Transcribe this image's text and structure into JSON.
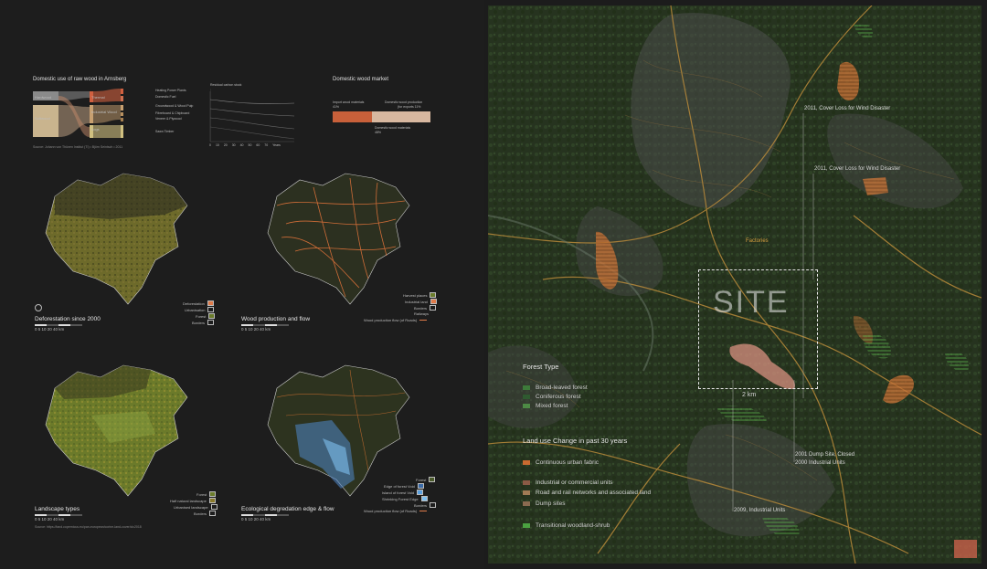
{
  "left": {
    "chart_title": "Domestic use of raw wood in Arnsberg",
    "sankey_sources": [
      "Hardwood",
      "Softwood"
    ],
    "sankey_mids": [
      "Thermal",
      "Industrial Wood",
      "Logs"
    ],
    "sankey_targets": [
      "Heating Power Plants",
      "Domestic Fuel",
      "Groundwood & Wood Pulp",
      "Fibreboard & Chipboard",
      "Veneer & Plywood",
      "Sawn Timber"
    ],
    "carbon_title": "Residual carbon stock",
    "carbon_axis": [
      "0",
      "10",
      "20",
      "30",
      "40",
      "50",
      "60",
      "70",
      "Years"
    ],
    "source_note": "Source: Johann von Thünen Institut (TI) • Björn Seintsch • 2011",
    "market": {
      "title": "Domestic wood market",
      "import_label": "Import wood materials",
      "import_pct": "41%",
      "production_label": "Domestic wood production",
      "production_sub": "(for exports 11%",
      "domestic_label": "Domestic wood materials",
      "domestic_pct": "48%"
    },
    "maps": [
      {
        "title": "Deforestation since 2000",
        "legend": [
          {
            "label": "Deforestation",
            "color": "#e07b4a"
          },
          {
            "label": "Urbanisation",
            "color": "#1d1d1d"
          },
          {
            "label": "Forest",
            "color": "#6b7c2b"
          },
          {
            "label": "Borders",
            "color": "#1d1d1d"
          }
        ]
      },
      {
        "title": "Wood production and flow",
        "legend": [
          {
            "label": "Harvest places",
            "color": "#6b7c2b"
          },
          {
            "label": "Industrial land",
            "color": "#e07b4a"
          },
          {
            "label": "Borders",
            "color": "#1d1d1d"
          },
          {
            "label": "Railways",
            "color": "#1d1d1d"
          },
          {
            "label": "Wood production flow (of Roads)",
            "color": "#e07b4a"
          }
        ]
      },
      {
        "title": "Landscape types",
        "legend": [
          {
            "label": "Forest",
            "color": "#6b7c2b"
          },
          {
            "label": "Half natural landscape",
            "color": "#8a7a2b"
          },
          {
            "label": "Urbanised landscape",
            "color": "#1d1d1d"
          },
          {
            "label": "Borders",
            "color": "#1d1d1d"
          }
        ]
      },
      {
        "title": "Ecological degredation edge & flow",
        "legend": [
          {
            "label": "Forest",
            "color": "#4a5a2a"
          },
          {
            "label": "Edge of forest Void",
            "color": "#3a6aa8"
          },
          {
            "label": "Island of forest Void",
            "color": "#5aa0e0"
          },
          {
            "label": "Shrinking Forest Edge",
            "color": "#7fc0f0"
          },
          {
            "label": "Borders",
            "color": "#1d1d1d"
          },
          {
            "label": "Wood production flow (of Roads)",
            "color": "#e07b4a"
          }
        ]
      }
    ],
    "scale_text": "0 5 10    20          40 km",
    "footer_source": "Source: https://land.copernicus.eu/pan-european/corine-land-cover/clc2018"
  },
  "right": {
    "site_label": "SITE",
    "scale_label": "2 km",
    "factories_label": "Factories",
    "annotations": [
      "2011, Cover Loss for Wind Disaster",
      "2011, Cover Loss for Wind Disaster",
      "2001 Dump Site, Closed",
      "2000 Industrial Units",
      "2009, Industrial Units"
    ],
    "forest_type": {
      "title": "Forest Type",
      "items": [
        {
          "label": "Broad-leaved forest",
          "color": "#3d7a3a"
        },
        {
          "label": "Coniferous forest",
          "color": "#2f5a30"
        },
        {
          "label": "Mixed forest",
          "color": "#4d8a45"
        }
      ]
    },
    "land_use": {
      "title": "Land use Change in past 30 years",
      "items": [
        {
          "label": "Continuous urban fabric",
          "color": "#c96a30"
        },
        {
          "label": "Industrial or commercial units",
          "color": "#8a5a45"
        },
        {
          "label": "Road and rail networks and associated land",
          "color": "#a07a55"
        },
        {
          "label": "Dump sites",
          "color": "#8a6a50"
        },
        {
          "label": "Transitional woodland-shrub",
          "color": "#4aa040"
        }
      ]
    }
  }
}
